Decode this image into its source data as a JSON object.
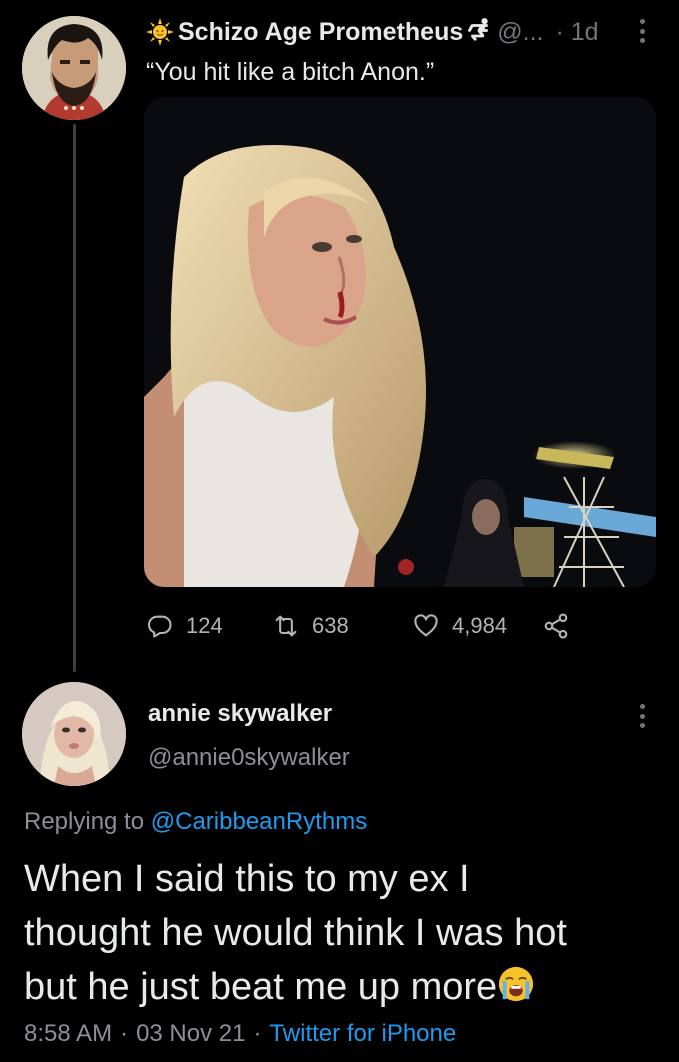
{
  "tweet1": {
    "display_name": "Schizo Age Prometheus",
    "name_glyph": "🮲",
    "handle": "@...",
    "time_separator": "·",
    "time": "1d",
    "text": "“You hit like a bitch Anon.”",
    "stats": {
      "replies": "124",
      "retweets": "638",
      "likes": "4,984"
    }
  },
  "tweet2": {
    "display_name": "annie skywalker",
    "handle": "@annie0skywalker",
    "replying_prefix": "Replying to",
    "replying_to": "@CaribbeanRythms",
    "body_lines": [
      "When I said this to my ex I",
      "thought he would think I was hot",
      "but he just beat me up more"
    ],
    "timestamp": "8:58 AM",
    "date": "03 Nov 21",
    "separator": "·",
    "source": "Twitter for iPhone"
  },
  "icons": {
    "sun": "sun-emoji-icon",
    "reply": "reply-icon",
    "retweet": "retweet-icon",
    "like": "heart-icon",
    "share": "share-icon",
    "more": "more-vertical-icon",
    "cry": "loudly-crying-face-emoji-icon"
  },
  "colors": {
    "background": "#000000",
    "text": "#e7e9ea",
    "secondary": "#71767b",
    "link": "#1d9bf0"
  }
}
